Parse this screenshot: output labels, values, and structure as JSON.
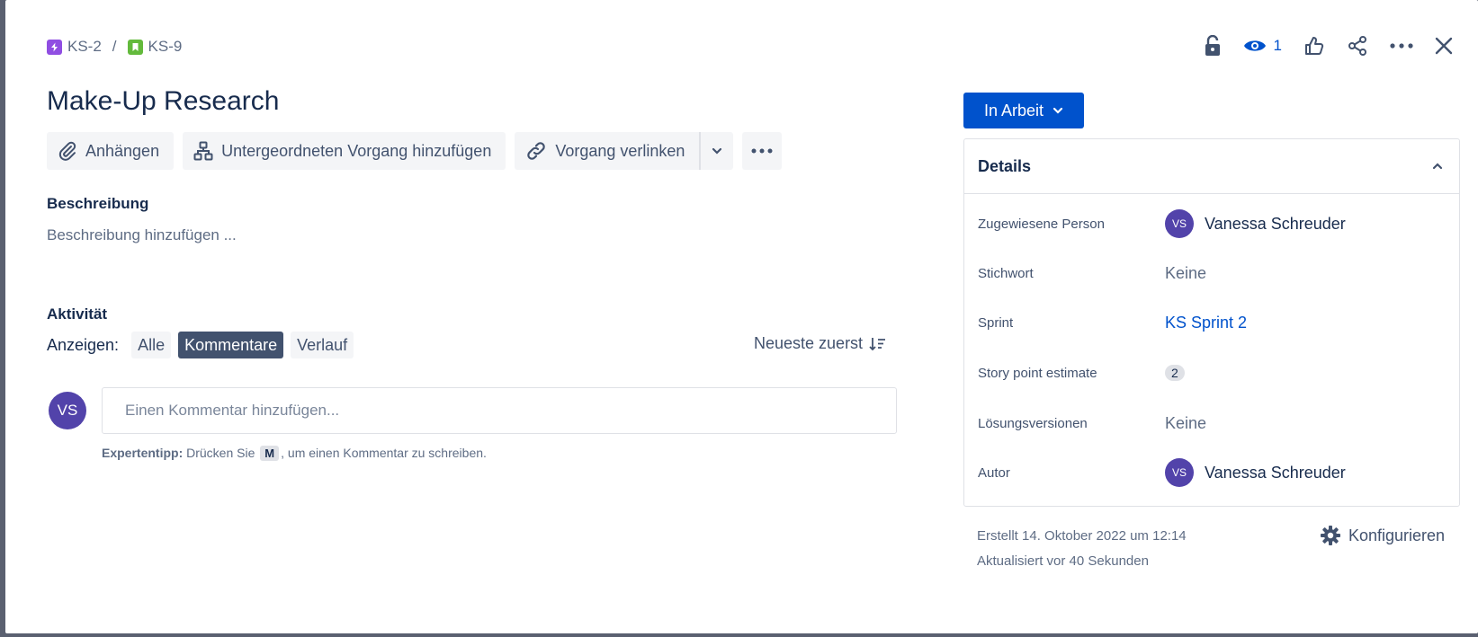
{
  "breadcrumb": {
    "parent": "KS-2",
    "separator": "/",
    "current": "KS-9"
  },
  "header": {
    "watch_count": "1"
  },
  "issue": {
    "title": "Make-Up Research"
  },
  "toolbar": {
    "attach_label": "Anhängen",
    "child_label": "Untergeordneten Vorgang hinzufügen",
    "link_label": "Vorgang verlinken"
  },
  "description": {
    "label": "Beschreibung",
    "placeholder": "Beschreibung hinzufügen ..."
  },
  "activity": {
    "label": "Aktivität",
    "show_label": "Anzeigen:",
    "filters": [
      {
        "label": "Alle"
      },
      {
        "label": "Kommentare"
      },
      {
        "label": "Verlauf"
      }
    ],
    "sort_label": "Neueste zuerst",
    "avatar_initials": "VS",
    "comment_placeholder": "Einen Kommentar hinzufügen...",
    "protip_bold": "Expertentipp:",
    "protip_pre": "Drücken Sie",
    "protip_key": "M",
    "protip_post": ", um einen Kommentar zu schreiben."
  },
  "status": {
    "label": "In Arbeit"
  },
  "details": {
    "title": "Details",
    "assignee_label": "Zugewiesene Person",
    "assignee_initials": "VS",
    "assignee_name": "Vanessa Schreuder",
    "labels_label": "Stichwort",
    "labels_value": "Keine",
    "sprint_label": "Sprint",
    "sprint_value": "KS Sprint 2",
    "points_label": "Story point estimate",
    "points_value": "2",
    "fix_label": "Lösungsversionen",
    "fix_value": "Keine",
    "reporter_label": "Autor",
    "reporter_initials": "VS",
    "reporter_name": "Vanessa Schreuder"
  },
  "meta": {
    "created": "Erstellt 14. Oktober 2022 um 12:14",
    "updated": "Aktualisiert vor 40 Sekunden",
    "configure_label": "Konfigurieren"
  },
  "colors": {
    "primary": "#0052cc",
    "text": "#172b4d",
    "subtle": "#42526e",
    "avatar": "#5243aa",
    "epic": "#904ee2",
    "story": "#63ba3c"
  }
}
